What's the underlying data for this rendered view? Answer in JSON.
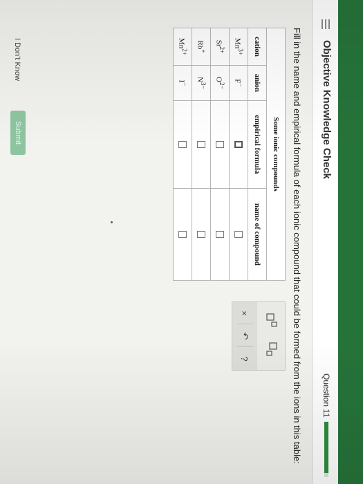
{
  "header": {
    "title": "Objective Knowledge Check",
    "question": "Question 11",
    "progress_fraction": 0.93
  },
  "instruction": "Fill in the name and empirical formula of each ionic compound that could be formed from the ions in this table:",
  "table": {
    "caption": "Some ionic compounds",
    "columns": [
      "cation",
      "anion",
      "empirical formula",
      "name of compound"
    ],
    "rows": [
      {
        "cation": {
          "base": "Mn",
          "charge": "3+"
        },
        "anion": {
          "base": "F",
          "charge": "−"
        }
      },
      {
        "cation": {
          "base": "Sr",
          "charge": "2+"
        },
        "anion": {
          "base": "O",
          "charge": "2−"
        }
      },
      {
        "cation": {
          "base": "Rb",
          "charge": "+"
        },
        "anion": {
          "base": "N",
          "charge": "3−"
        }
      },
      {
        "cation": {
          "base": "Mn",
          "charge": "2+"
        },
        "anion": {
          "base": "I",
          "charge": "−"
        }
      }
    ]
  },
  "keypad": {
    "clear_symbol": "×",
    "undo_symbol": "↶",
    "help_symbol": "?"
  },
  "footer": {
    "dont_know_label": "I Don't Know",
    "submit_label": "Submit"
  },
  "colors": {
    "brand": "#26733a",
    "submit": "#8ec5a0"
  }
}
